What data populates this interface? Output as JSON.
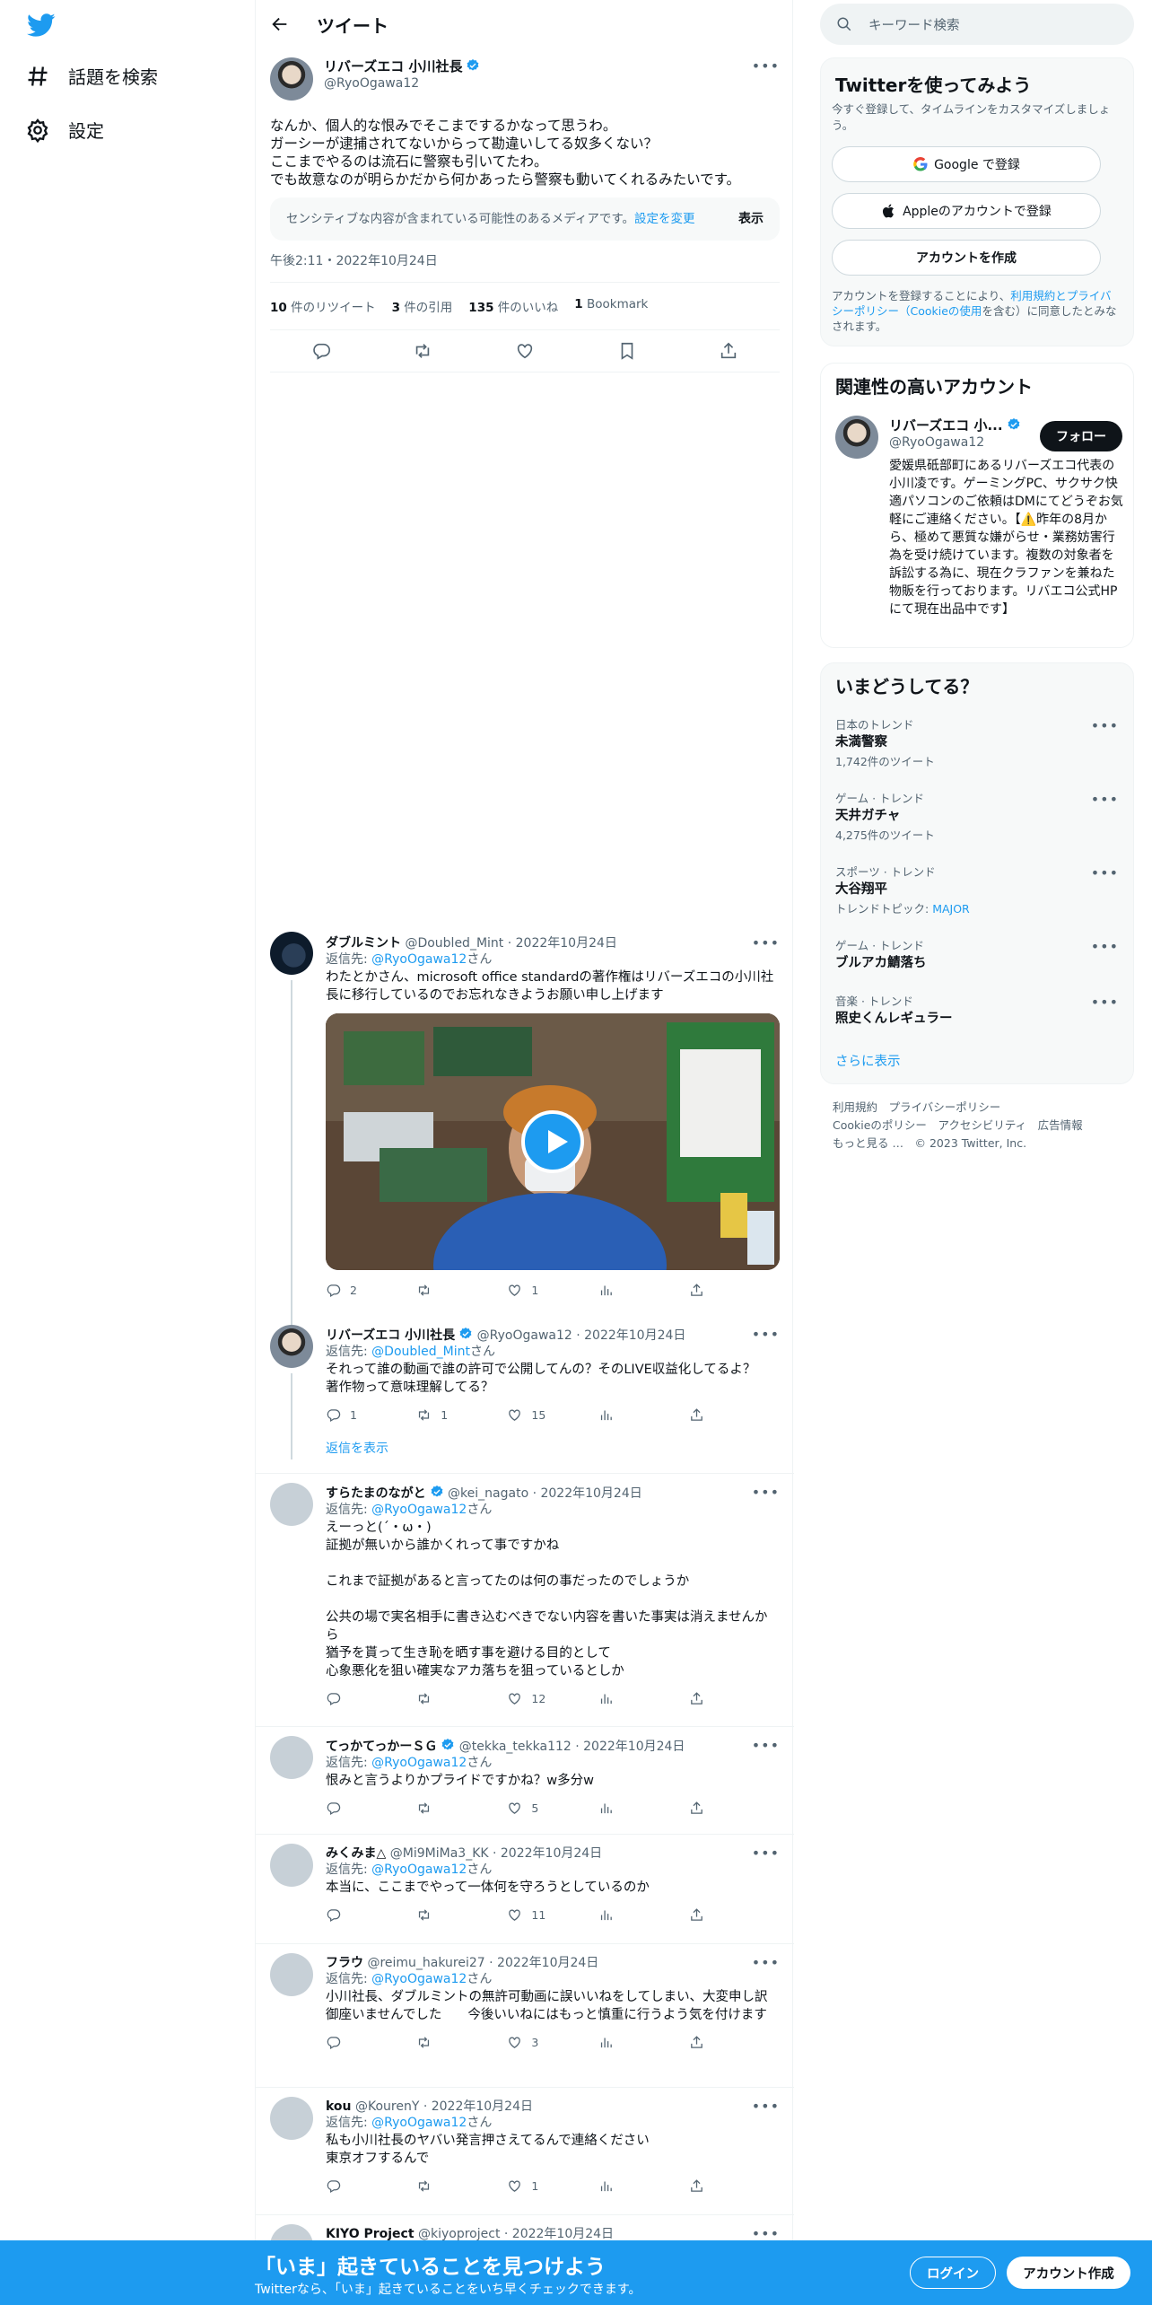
{
  "nav": {
    "explore_label": "話題を検索",
    "settings_label": "設定"
  },
  "header": {
    "title": "ツイート"
  },
  "focused_tweet": {
    "name": "リバーズエコ 小川社長",
    "handle": "@RyoOgawa12",
    "text": "なんか、個人的な恨みでそこまでするかなって思うわ。\nガーシーが逮捕されてないからって勘違いしてる奴多くない？\nここまでやるのは流石に警察も引いてたわ。\nでも故意なのが明らかだから何かあったら警察も動いてくれるみたいです。",
    "sensitive_text": "センシティブな内容が含まれている可能性のあるメディアです。",
    "sensitive_link": "設定を変更",
    "sensitive_show": "表示",
    "timestamp": "午後2:11・2022年10月24日",
    "retweets": "10",
    "retweets_label": "件のリツイート",
    "quotes": "3",
    "quotes_label": "件の引用",
    "likes": "135",
    "likes_label": "件のいいね",
    "bookmarks": "1",
    "bookmarks_label": "Bookmark"
  },
  "replies": [
    {
      "name": "ダブルミント",
      "meta": "@Doubled_Mint · 2022年10月24日",
      "to_prefix": "返信先: ",
      "to": "@RyoOgawa12",
      "to_suffix": "さん",
      "text": "わたとかさん、microsoft office standardの著作権はリバーズエコの小川社長に移行しているのでお忘れなきようお願い申し上げます",
      "reply_count": "2",
      "retweet_count": "",
      "like_count": "1"
    },
    {
      "name": "リバーズエコ 小川社長",
      "meta": "@RyoOgawa12 · 2022年10月24日",
      "to_prefix": "返信先: ",
      "to": "@Doubled_Mint",
      "to_suffix": "さん",
      "text": "それって誰の動画で誰の許可で公開してんの？そのLIVE収益化してるよ？\n著作物って意味理解してる？",
      "reply_count": "1",
      "retweet_count": "1",
      "like_count": "15"
    },
    {
      "name": "すらたまのながと",
      "meta": "@kei_nagato · 2022年10月24日",
      "to_prefix": "返信先: ",
      "to": "@RyoOgawa12",
      "to_suffix": "さん",
      "text": "えーっと(´・ω・)\n証拠が無いから誰かくれって事ですかね\n\nこれまで証拠があると言ってたのは何の事だったのでしょうか\n\n公共の場で実名相手に書き込むべきでない内容を書いた事実は消えませんから\n猶予を貰って生き恥を晒す事を避ける目的として\n心象悪化を狙い確実なアカ落ちを狙っているとしか",
      "reply_count": "",
      "retweet_count": "",
      "like_count": "12"
    },
    {
      "name": "てっかてっかーＳＧ",
      "meta": "@tekka_tekka112 · 2022年10月24日",
      "to_prefix": "返信先: ",
      "to": "@RyoOgawa12",
      "to_suffix": "さん",
      "text": "恨みと言うよりかプライドですかね？w多分w",
      "reply_count": "",
      "retweet_count": "",
      "like_count": "5"
    },
    {
      "name": "みくみま△",
      "meta": "@Mi9MiMa3_KK · 2022年10月24日",
      "to_prefix": "返信先: ",
      "to": "@RyoOgawa12",
      "to_suffix": "さん",
      "text": "本当に、ここまでやって一体何を守ろうとしているのか",
      "reply_count": "",
      "retweet_count": "",
      "like_count": "11"
    },
    {
      "name": "フラウ",
      "meta": "@reimu_hakurei27 · 2022年10月24日",
      "to_prefix": "返信先: ",
      "to": "@RyoOgawa12",
      "to_suffix": "さん",
      "text": "小川社長、ダブルミントの無許可動画に誤いいねをしてしまい、大変申し訳御座いませんでした　　今後いいねにはもっと慎重に行うよう気を付けます",
      "reply_count": "",
      "retweet_count": "",
      "like_count": "3"
    },
    {
      "name": "kou",
      "meta": "@KourenY · 2022年10月24日",
      "to_prefix": "返信先: ",
      "to": "@RyoOgawa12",
      "to_suffix": "さん",
      "text": "私も小川社長のヤバい発言押さえてるんで連絡ください\n東京オフするんで",
      "reply_count": "",
      "retweet_count": "",
      "like_count": "1"
    },
    {
      "name": "KIYO Project",
      "meta": "@kiyoproject · 2022年10月24日"
    }
  ],
  "show_replies": "返信を表示",
  "right": {
    "search_placeholder": "キーワード検索",
    "signup": {
      "title": "Twitterを使ってみよう",
      "desc": "今すぐ登録して、タイムラインをカスタマイズしましょう。",
      "google": "Google で登録",
      "apple": "Appleのアカウントで登録",
      "create": "アカウントを作成",
      "terms_pre": "アカウントを登録することにより、",
      "terms_link": "利用規約とプライバシーポリシー（Cookieの使用",
      "terms_post": "を含む）に同意したとみなされます。"
    },
    "related": {
      "title": "関連性の高いアカウント",
      "name": "リバーズエコ 小...",
      "handle": "@RyoOgawa12",
      "follow": "フォロー",
      "bio": "愛媛県砥部町にあるリバーズエコ代表の小川凌です。ゲーミングPC、サクサク快適パソコンのご依頼はDMにてどうぞお気軽にご連絡ください。【⚠️昨年の8月から、極めて悪質な嫌がらせ・業務妨害行為を受け続けています。複数の対象者を訴訟する為に、現在クラファンを兼ねた物販を行っております。リバエコ公式HPにて現在出品中です】"
    },
    "trends": {
      "title": "いまどうしてる？",
      "items": [
        {
          "cat": "日本のトレンド",
          "name": "未満警察",
          "sub": "1,742件のツイート"
        },
        {
          "cat": "ゲーム · トレンド",
          "name": "天井ガチャ",
          "sub": "4,275件のツイート"
        },
        {
          "cat": "スポーツ · トレンド",
          "name": "大谷翔平",
          "sub_prefix": "トレンドトピック: ",
          "sub_link": "MAJOR"
        },
        {
          "cat": "ゲーム · トレンド",
          "name": "ブルアカ鯖落ち"
        },
        {
          "cat": "音楽 · トレンド",
          "name": "照史くんレギュラー"
        }
      ],
      "more": "さらに表示"
    },
    "footer": {
      "l1a": "利用規約",
      "l1b": "プライバシーポリシー",
      "l2a": "Cookieのポリシー",
      "l2b": "アクセシビリティ",
      "l2c": "広告情報",
      "l3a": "もっと見る …",
      "l3b": "© 2023 Twitter, Inc."
    }
  },
  "bottombar": {
    "headline": "「いま」起きていることを見つけよう",
    "sub": "Twitterなら、「いま」起きていることをいち早くチェックできます。",
    "login": "ログイン",
    "create": "アカウント作成"
  },
  "colors": {
    "accent": "#1d9bf0",
    "text": "#0f1419",
    "muted": "#536471"
  }
}
